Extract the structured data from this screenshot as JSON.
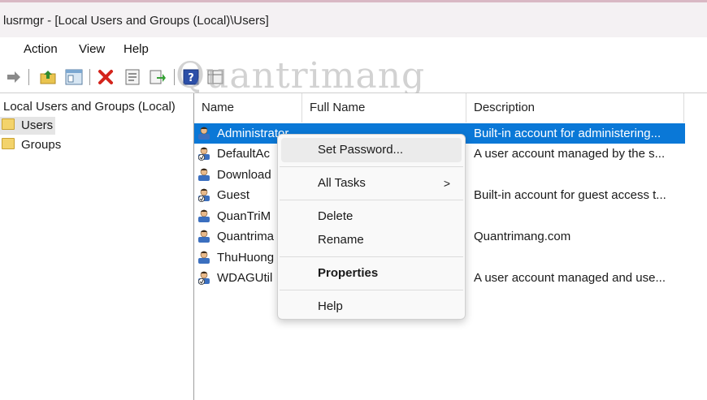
{
  "window": {
    "title": "lusrmgr - [Local Users and Groups (Local)\\Users]"
  },
  "menu": {
    "items": [
      {
        "label": "Action"
      },
      {
        "label": "View"
      },
      {
        "label": "Help"
      }
    ]
  },
  "toolbar": {
    "icons": [
      "forward-arrow-icon",
      "up-folder-icon",
      "show-hide-tree-icon",
      "delete-icon",
      "properties-icon",
      "export-list-icon",
      "help-icon",
      "details-view-icon"
    ]
  },
  "tree": {
    "root": "Local Users and Groups (Local)",
    "items": [
      {
        "label": "Users",
        "selected": true
      },
      {
        "label": "Groups",
        "selected": false
      }
    ]
  },
  "list": {
    "columns": [
      "Name",
      "Full Name",
      "Description"
    ],
    "rows": [
      {
        "name": "Administrator",
        "full_name": "",
        "description": "Built-in account for administering...",
        "selected": true,
        "disabled": false
      },
      {
        "name": "DefaultAc",
        "full_name": "",
        "description": "A user account managed by the s...",
        "selected": false,
        "disabled": true
      },
      {
        "name": "Download",
        "full_name": "",
        "description": "",
        "selected": false,
        "disabled": false
      },
      {
        "name": "Guest",
        "full_name": "",
        "description": "Built-in account for guest access t...",
        "selected": false,
        "disabled": true
      },
      {
        "name": "QuanTriM",
        "full_name": "",
        "description": "",
        "selected": false,
        "disabled": false
      },
      {
        "name": "Quantrima",
        "full_name": "",
        "description": "Quantrimang.com",
        "selected": false,
        "disabled": false
      },
      {
        "name": "ThuHuong",
        "full_name": "",
        "description": "",
        "selected": false,
        "disabled": false
      },
      {
        "name": "WDAGUtil",
        "full_name": "",
        "description": "A user account managed and use...",
        "selected": false,
        "disabled": true
      }
    ]
  },
  "context_menu": {
    "items": [
      {
        "label": "Set Password..."
      },
      {
        "label": "All Tasks",
        "submenu_arrow": ">"
      },
      {
        "label": "Delete"
      },
      {
        "label": "Rename"
      },
      {
        "label": "Properties"
      },
      {
        "label": "Help"
      }
    ]
  },
  "watermark": {
    "text": "Quantrimang"
  },
  "colors": {
    "selection": "#0a78d7",
    "title_accent": "#d9b8c4"
  }
}
